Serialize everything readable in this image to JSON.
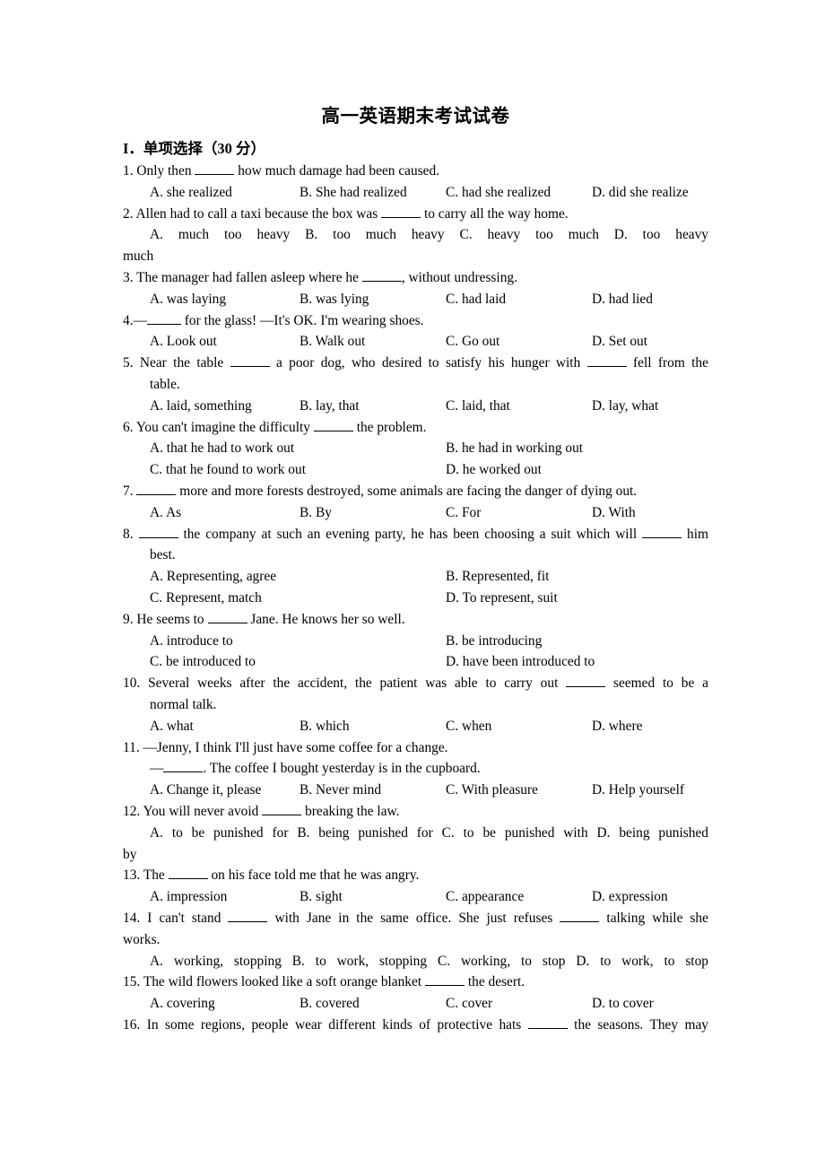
{
  "document": {
    "title": "高一英语期末考试试卷",
    "section": {
      "roman": "I",
      "label": "单项选择",
      "points": "（30 分）"
    }
  },
  "questions": [
    {
      "number": "1.",
      "stem_before": "Only then",
      "stem_after": "how much damage had been caused.",
      "options": [
        "A. she realized",
        "B. She had realized",
        "C. had she realized",
        "D. did she realize"
      ],
      "layout": "row4"
    },
    {
      "number": "2.",
      "stem_before": "Allen had to call a taxi because the box was",
      "stem_after": "to carry all the way home.",
      "options": [
        "A. much too heavy",
        "B. too much heavy",
        "C. heavy too much",
        "D.",
        "too",
        "heavy"
      ],
      "options_wrap": "much",
      "layout": "spread-wrap"
    },
    {
      "number": "3.",
      "stem_before": "The manager had fallen asleep where he",
      "stem_after": ", without undressing.",
      "options": [
        "A. was laying",
        "B. was lying",
        "C. had laid",
        "D. had lied"
      ],
      "layout": "row4"
    },
    {
      "number": "4.",
      "stem_before": "—",
      "stem_after": "for the glass! —It's OK. I'm wearing shoes.",
      "options": [
        "A. Look out",
        "B. Walk out",
        "C. Go out",
        "D. Set out"
      ],
      "layout": "row4"
    },
    {
      "number": "5.",
      "stem_before": "Near the table",
      "stem_mid": "a poor dog, who desired to satisfy his hunger with",
      "stem_after": "fell from the",
      "stem_cont": "table.",
      "options": [
        "A. laid, something",
        "B. lay, that",
        "C. laid, that",
        "D. lay, what"
      ],
      "layout": "row4-q5"
    },
    {
      "number": "6.",
      "stem_before": "You can't imagine the difficulty",
      "stem_after": "the problem.",
      "options": [
        "A. that he had to work out",
        "B. he had in working out",
        "C. that he found to work out",
        "D. he worked out"
      ],
      "layout": "col2"
    },
    {
      "number": "7.",
      "stem_before": "",
      "stem_after": "more and more forests destroyed, some animals are facing the danger of dying out.",
      "options": [
        "A. As",
        "B. By",
        "C. For",
        "D. With"
      ],
      "layout": "row4"
    },
    {
      "number": "8.",
      "stem_before": "",
      "stem_mid": "the company at such an evening party, he has been choosing a suit which will",
      "stem_after": "him",
      "stem_cont": "best.",
      "options": [
        "A. Representing, agree",
        "B. Represented, fit",
        "C. Represent, match",
        "D. To represent, suit"
      ],
      "layout": "col2"
    },
    {
      "number": "9.",
      "stem_before": "He seems to",
      "stem_after": "Jane. He knows her so well.",
      "options": [
        "A. introduce to",
        "B. be introducing",
        "C. be introduced to",
        "D. have been introduced to"
      ],
      "layout": "col2"
    },
    {
      "number": "10.",
      "stem_before": "Several weeks after the accident, the patient was able to carry out",
      "stem_after": "seemed to be a",
      "stem_cont": "normal talk.",
      "options": [
        "A. what",
        "B. which",
        "C. when",
        "D. where"
      ],
      "layout": "row4-just"
    },
    {
      "number": "11.",
      "stem_before": "—Jenny, I think I'll just have some coffee for a change.",
      "stem_reply_before": "—",
      "stem_reply_after": ". The coffee I bought yesterday is in the cupboard.",
      "options": [
        "A. Change it, please",
        "B. Never mind",
        "C. With pleasure",
        "D. Help yourself"
      ],
      "layout": "row4-dialog"
    },
    {
      "number": "12.",
      "stem_before": "You will never avoid",
      "stem_after": "breaking the law.",
      "options": [
        "A. to be punished for",
        "B. being punished for",
        "C. to be punished with",
        "D. being punished"
      ],
      "options_wrap": "by",
      "layout": "spread-wrap2"
    },
    {
      "number": "13.",
      "stem_before": "The",
      "stem_after": "on his face told me that he was angry.",
      "options": [
        "A. impression",
        "B. sight",
        "C. appearance",
        "D. expression"
      ],
      "layout": "row4"
    },
    {
      "number": "14.",
      "stem_before": "I can't stand",
      "stem_mid": "with Jane in the same office. She just refuses",
      "stem_after": "talking while she",
      "stem_cont_flush": "works.",
      "options": [
        "A. working, stopping",
        "B. to work, stopping",
        "C. working, to stop",
        "D. to work, to stop"
      ],
      "layout": "row4-wide"
    },
    {
      "number": "15.",
      "stem_before": "The wild flowers looked like a soft orange blanket",
      "stem_after": "the desert.",
      "options": [
        "A. covering",
        "B. covered",
        "C. cover",
        "D. to cover"
      ],
      "layout": "row4"
    },
    {
      "number": "16.",
      "stem_before": "In some regions, people wear different kinds of protective hats",
      "stem_after": "the seasons. They may",
      "options": [],
      "layout": "stem-only"
    }
  ]
}
